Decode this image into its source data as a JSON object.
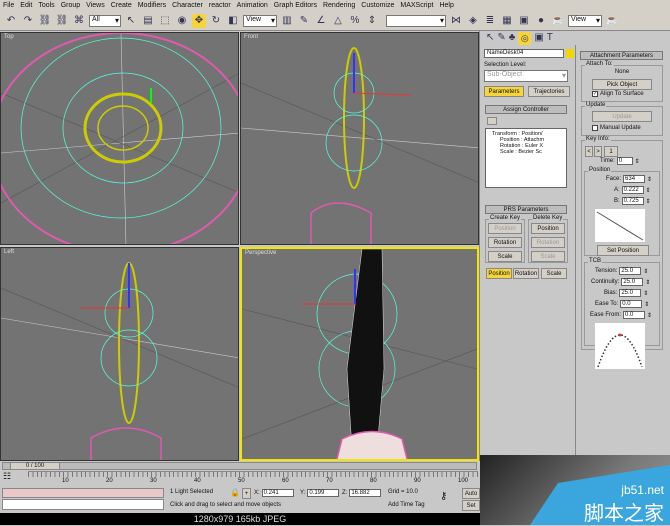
{
  "menu": [
    "File",
    "Edit",
    "Tools",
    "Group",
    "Views",
    "Create",
    "Modifiers",
    "Character",
    "reactor",
    "Animation",
    "Graph Editors",
    "Rendering",
    "Customize",
    "MAXScript",
    "Help"
  ],
  "toolbar": {
    "selection_filter": "All",
    "ref_coord": "View",
    "ref_coord2": "View"
  },
  "viewports": [
    {
      "label": "Top"
    },
    {
      "label": "Front"
    },
    {
      "label": "Left"
    },
    {
      "label": "Perspective"
    }
  ],
  "command_panel": {
    "object_name": "NameDesk04",
    "selection_level_label": "Selection Level:",
    "sub_object": "Sub-Object",
    "tabs": [
      "Parameters",
      "Trajectories"
    ],
    "assign_controller": {
      "title": "Assign Controller",
      "tree": [
        "Transform : Position/",
        "Position : Attachm",
        "Rotation : Euler X",
        "Scale : Bezier Sc"
      ]
    },
    "prs": {
      "title": "PRS Parameters",
      "create_key": "Create Key",
      "delete_key": "Delete Key",
      "create_buttons": [
        "Position",
        "Rotation",
        "Scale"
      ],
      "delete_buttons": [
        "Position",
        "Rotation",
        "Scale"
      ],
      "bottom_tabs": [
        "Position",
        "Rotation",
        "Scale"
      ]
    },
    "attachment": {
      "title": "Attachment Parameters",
      "attach_to": "Attach To:",
      "object": "None",
      "pick_object": "Pick Object",
      "align": "Align To Surface",
      "update_group": "Update",
      "update_btn": "Update",
      "manual_update": "Manual Update",
      "key_info": "Key Info:",
      "key_num": "1",
      "time_label": "Time:",
      "time": "0",
      "position_group": "Position",
      "face_label": "Face:",
      "face": "634",
      "a_label": "A:",
      "a": "0.222",
      "b_label": "B:",
      "b": "0.725",
      "set_position": "Set Position",
      "tcb": "TCB",
      "tension_label": "Tension:",
      "tension": "25.0",
      "continuity_label": "Continuity:",
      "continuity": "25.0",
      "bias_label": "Bias:",
      "bias": "25.0",
      "ease_to_label": "Ease To:",
      "ease_to": "0.0",
      "ease_from_label": "Ease From:",
      "ease_from": "0.0"
    }
  },
  "timeline": {
    "frame": "0 / 100",
    "ticks": [
      "10",
      "20",
      "30",
      "40",
      "50",
      "60",
      "70",
      "80",
      "90",
      "100"
    ]
  },
  "status": {
    "selected": "1 Light Selected",
    "x_label": "X:",
    "x": "0.241",
    "y_label": "Y:",
    "y": "0.199",
    "z_label": "Z:",
    "z": "16.882",
    "grid": "Grid = 10.0",
    "prompt": "Click and drag to select and move objects",
    "add_time_tag": "Add Time Tag",
    "auto": "Auto",
    "set": "Set"
  },
  "image_info": "1280x979  165kb  JPEG",
  "watermark": {
    "site": "jb51.net",
    "name": "脚本之家"
  }
}
